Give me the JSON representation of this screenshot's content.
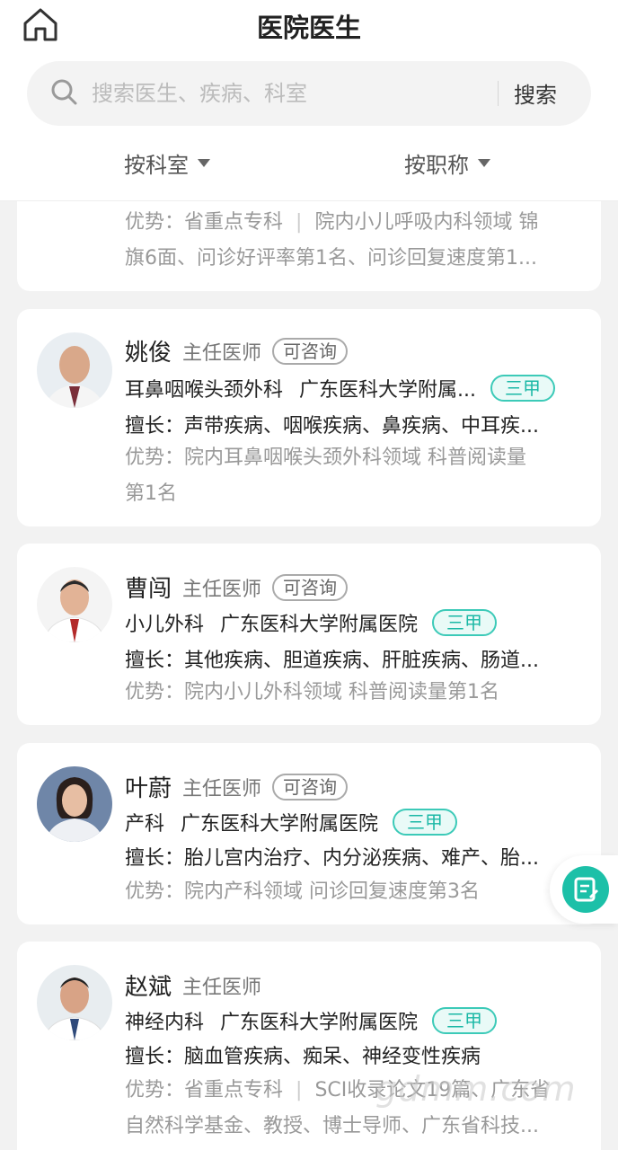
{
  "header": {
    "title": "医院医生",
    "search_placeholder": "搜索医生、疾病、科室",
    "search_button": "搜索",
    "filters": [
      "按科室",
      "按职称"
    ]
  },
  "partial_card": {
    "advantage_tag": "省重点专科",
    "advantage_line1": "院内小儿呼吸内科领域 锦",
    "advantage_line2": "旗6面、问诊好评率第1名、问诊回复速度第1..."
  },
  "doctors": [
    {
      "name": "姚俊",
      "title": "主任医师",
      "consult": "可咨询",
      "dept": "耳鼻咽喉头颈外科",
      "hospital": "广东医科大学附属...",
      "level": "三甲",
      "skill": "擅长：声带疾病、咽喉疾病、鼻疾病、中耳疾...",
      "advantage_line1": "优势：院内耳鼻咽喉头颈外科领域 科普阅读量",
      "advantage_line2": "第1名"
    },
    {
      "name": "曹闯",
      "title": "主任医师",
      "consult": "可咨询",
      "dept": "小儿外科",
      "hospital": "广东医科大学附属医院",
      "level": "三甲",
      "skill": "擅长：其他疾病、胆道疾病、肝脏疾病、肠道...",
      "advantage_line1": "优势：院内小儿外科领域 科普阅读量第1名"
    },
    {
      "name": "叶蔚",
      "title": "主任医师",
      "consult": "可咨询",
      "dept": "产科",
      "hospital": "广东医科大学附属医院",
      "level": "三甲",
      "skill": "擅长：胎儿宫内治疗、内分泌疾病、难产、胎...",
      "advantage_line1": "优势：院内产科领域 问诊回复速度第3名"
    },
    {
      "name": "赵斌",
      "title": "主任医师",
      "dept": "神经内科",
      "hospital": "广东医科大学附属医院",
      "level": "三甲",
      "skill": "擅长：脑血管疾病、痴呆、神经变性疾病",
      "advantage_prefix": "优势：省重点专科",
      "advantage_line1_rest": "SCI收录论文19篇、广东省",
      "advantage_line2": "自然科学基金、教授、博士导师、广东省科技..."
    }
  ],
  "watermark": "gdmm.com",
  "icons": {
    "home": "home-icon",
    "search": "search-icon",
    "caret": "caret-down-icon",
    "float": "edit-note-icon"
  },
  "colors": {
    "accent": "#1cc0a8",
    "level_tag": "#1bb8a6",
    "background": "#f2f2f2"
  }
}
